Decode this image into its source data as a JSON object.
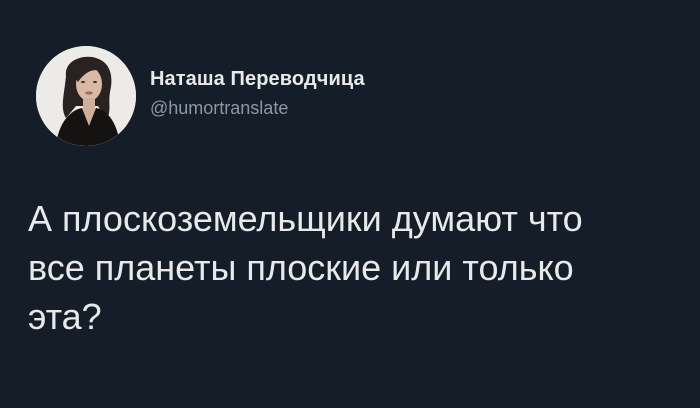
{
  "author": {
    "display_name": "Наташа Переводчица",
    "handle": "@humortranslate",
    "avatar_icon": "profile-photo-woman"
  },
  "tweet": {
    "text": "А плоскоземельщики думают что\nвсе планеты плоские или только\nэта?"
  },
  "colors": {
    "background": "#151d28",
    "text_primary": "#e7e9ea",
    "text_secondary": "#8b98a5"
  }
}
